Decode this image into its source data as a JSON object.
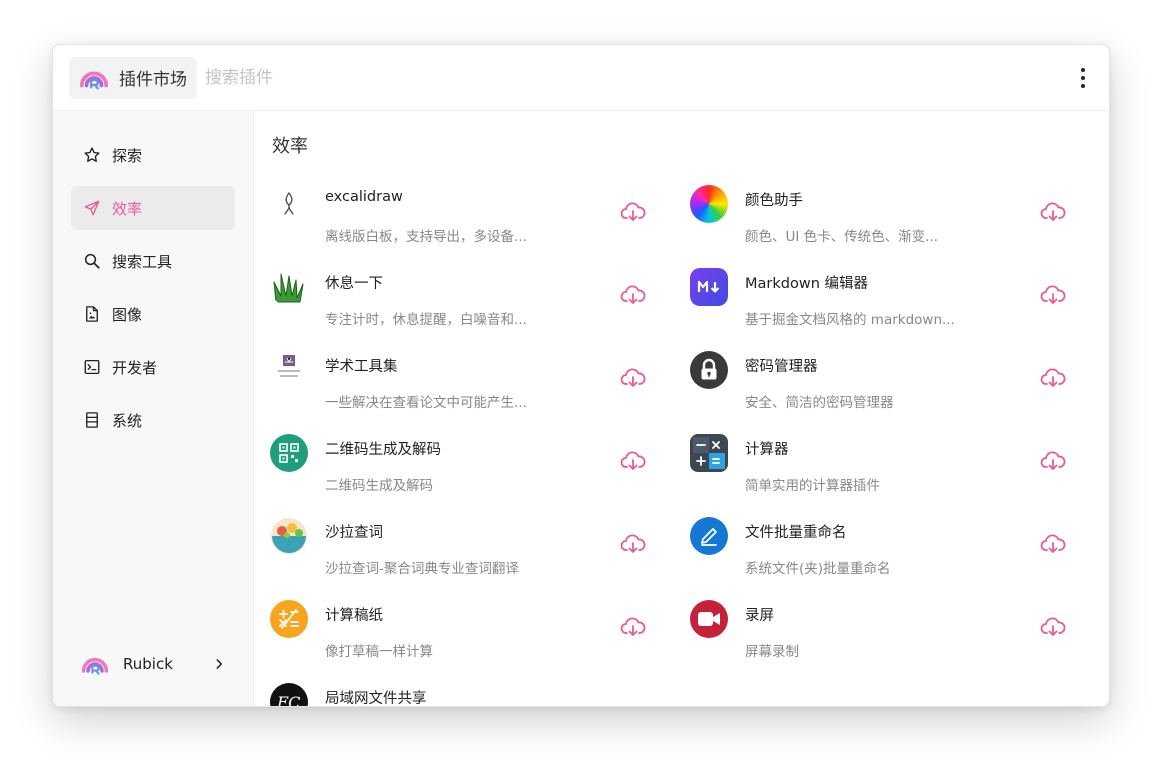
{
  "header": {
    "app_title": "插件市场",
    "search_placeholder": "搜索插件",
    "search_value": ""
  },
  "sidebar": {
    "items": [
      {
        "label": "探索",
        "icon": "star-icon",
        "active": false
      },
      {
        "label": "效率",
        "icon": "send-icon",
        "active": true
      },
      {
        "label": "搜索工具",
        "icon": "search-icon",
        "active": false
      },
      {
        "label": "图像",
        "icon": "image-file-icon",
        "active": false
      },
      {
        "label": "开发者",
        "icon": "terminal-icon",
        "active": false
      },
      {
        "label": "系统",
        "icon": "system-icon",
        "active": false
      }
    ],
    "user": {
      "name": "Rubick"
    }
  },
  "main": {
    "section_title": "效率",
    "plugins": [
      {
        "name": "excalidraw",
        "desc": "离线版白板，支持导出，多设备...",
        "icon": "excalidraw-icon"
      },
      {
        "name": "颜色助手",
        "desc": "颜色、UI 色卡、传统色、渐变...",
        "icon": "color-wheel-icon"
      },
      {
        "name": "休息一下",
        "desc": "专注计时，休息提醒，白噪音和...",
        "icon": "grass-icon"
      },
      {
        "name": "Markdown 编辑器",
        "desc": "基于掘金文档风格的 markdown...",
        "icon": "markdown-icon"
      },
      {
        "name": "学术工具集",
        "desc": "一些解决在查看论文中可能产生...",
        "icon": "thesis-tools-icon"
      },
      {
        "name": "密码管理器",
        "desc": "安全、简洁的密码管理器",
        "icon": "lock-icon"
      },
      {
        "name": "二维码生成及解码",
        "desc": "二维码生成及解码",
        "icon": "qrcode-icon"
      },
      {
        "name": "计算器",
        "desc": "简单实用的计算器插件",
        "icon": "calculator-icon"
      },
      {
        "name": "沙拉查词",
        "desc": "沙拉查词-聚合词典专业查词翻译",
        "icon": "salad-icon"
      },
      {
        "name": "文件批量重命名",
        "desc": "系统文件(夹)批量重命名",
        "icon": "pencil-icon"
      },
      {
        "name": "计算稿纸",
        "desc": "像打草稿一样计算",
        "icon": "math-paper-icon"
      },
      {
        "name": "录屏",
        "desc": "屏幕录制",
        "icon": "video-camera-icon"
      },
      {
        "name": "局域网文件共享",
        "desc": "",
        "icon": "lan-share-icon"
      }
    ],
    "download_icon": "cloud-download-icon"
  },
  "colors": {
    "accent": "#ea5b95",
    "sidebar_bg": "#f8f8f8",
    "active_bg": "#ebebeb"
  }
}
